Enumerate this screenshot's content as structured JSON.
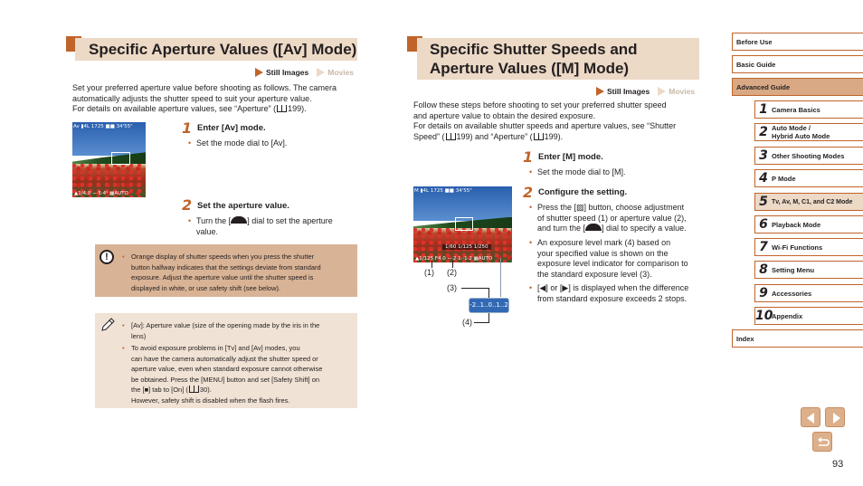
{
  "left": {
    "title": "Specific Aperture Values ([Av] Mode)",
    "modes": {
      "still": "Still Images",
      "movies": "Movies"
    },
    "intro": [
      "Set your preferred aperture value before shooting as follows. The camera",
      "automatically adjusts the shutter speed to suit your aperture value.",
      "For details on available aperture values, see “Aperture” (",
      "199)."
    ],
    "photo_hud": {
      "top": "Av ▮4L 1725 ■■ 34'55\"",
      "bottom": "▲1/4.0     −·5·4¹     ▦AUTO"
    },
    "steps": [
      {
        "num": "1",
        "title": "Enter [Av] mode.",
        "bullets": [
          "Set the mode dial to [Av]."
        ]
      },
      {
        "num": "2",
        "title": "Set the aperture value.",
        "bullets": [
          "Turn the [",
          "] dial to set the aperture",
          "value."
        ]
      }
    ],
    "caution": [
      "Orange display of shutter speeds when you press the shutter",
      "button halfway indicates that the settings deviate from standard",
      "exposure. Adjust the aperture value until the shutter speed is",
      "displayed in white, or use safety shift (see below)."
    ],
    "notes": {
      "item1": [
        "[Av]: Aperture value (size of the opening made by the iris in the",
        "lens)"
      ],
      "item2": [
        "To avoid exposure problems in [Tv] and [Av] modes, you",
        "can have the camera automatically adjust the shutter speed or",
        "aperture value, even when standard exposure cannot otherwise",
        "be obtained. Press the [MENU] button and set [Safety Shift] on",
        "the [■] tab to [On] (",
        "30).",
        "However, safety shift is disabled when the flash fires."
      ]
    }
  },
  "right": {
    "title_line1": "Specific Shutter Speeds and",
    "title_line2": "Aperture Values ([M] Mode)",
    "modes": {
      "still": "Still Images",
      "movies": "Movies"
    },
    "intro": [
      "Follow these steps before shooting to set your preferred shutter speed",
      "and aperture value to obtain the desired exposure.",
      "For details on available shutter speeds and aperture values, see “Shutter",
      "Speed” (",
      "199) and “Aperture” (",
      "199)."
    ],
    "photo_hud": {
      "top": "M ▮4L 1725 ■■ 34'55\"",
      "scale": "1/60   1/125   1/250",
      "bottom": "▲1/125    F4.0   −·2·1··1·2    ▦AUTO"
    },
    "labels": {
      "l1": "(1)",
      "l2": "(2)",
      "l3": "(3)",
      "l4": "(4)",
      "ev": "-2..1..0..1..2"
    },
    "steps": [
      {
        "num": "1",
        "title": "Enter [M] mode.",
        "bullets": [
          "Set the mode dial to [M]."
        ]
      },
      {
        "num": "2",
        "title": "Configure the setting.",
        "bullets": [
          [
            "Press the [▨] button, choose adjustment",
            "of shutter speed (1) or aperture value (2),",
            "and turn the [",
            "] dial to specify a value."
          ],
          [
            "An exposure level mark (4) based on",
            "your specified value is shown on the",
            "exposure level indicator for comparison to",
            "the standard exposure level (3)."
          ],
          [
            "[◀] or [▶] is displayed when the difference",
            "from standard exposure exceeds 2 stops."
          ]
        ]
      }
    ]
  },
  "sidebar": {
    "top_items": [
      "Before Use",
      "Basic Guide",
      "Advanced Guide"
    ],
    "chapters": [
      {
        "num": "1",
        "label": "Camera Basics"
      },
      {
        "num": "2",
        "label": "Auto Mode /",
        "label2": "Hybrid Auto Mode"
      },
      {
        "num": "3",
        "label": "Other Shooting Modes"
      },
      {
        "num": "4",
        "label": "P Mode"
      },
      {
        "num": "5",
        "label": "Tv, Av, M, C1, and C2 Mode"
      },
      {
        "num": "6",
        "label": "Playback Mode"
      },
      {
        "num": "7",
        "label": "Wi-Fi Functions"
      },
      {
        "num": "8",
        "label": "Setting Menu"
      },
      {
        "num": "9",
        "label": "Accessories"
      },
      {
        "num": "10",
        "label": "Appendix"
      }
    ],
    "index": "Index"
  },
  "page_number": "93",
  "colors": {
    "accent": "#c0642b",
    "band": "#ecd9c6",
    "caution_bg": "#d9b395",
    "note_bg": "#f0e2d4"
  }
}
